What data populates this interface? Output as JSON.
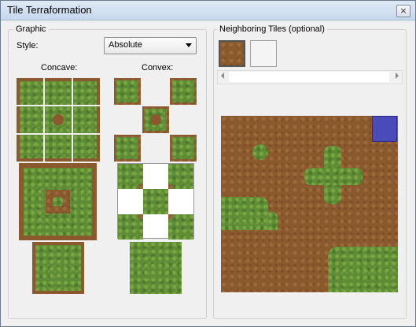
{
  "window": {
    "title": "Tile Terraformation",
    "close_glyph": "×"
  },
  "graphic": {
    "group_label": "Graphic",
    "style_label": "Style:",
    "style_value": "Absolute",
    "concave_label": "Concave:",
    "convex_label": "Convex:"
  },
  "neighbors": {
    "group_label": "Neighboring Tiles (optional)"
  },
  "colors": {
    "grass": "#5e8c36",
    "dirt": "#8a5a2e",
    "selection": "#4a4ab8"
  }
}
